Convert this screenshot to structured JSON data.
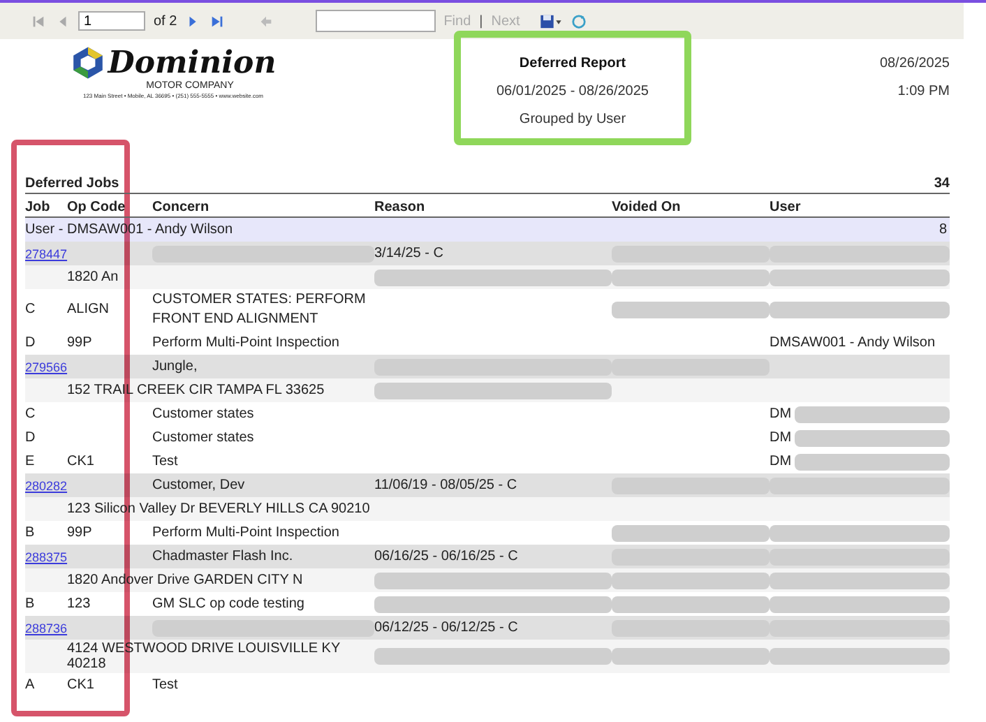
{
  "toolbar": {
    "page": "1",
    "page_count": "of 2",
    "find_label": "Find",
    "separator": "|",
    "next_label": "Next",
    "next_disabled": true
  },
  "header": {
    "logo_name": "Dominion",
    "logo_sub": "MOTOR COMPANY",
    "address": "123 Main Street • Mobile, AL 36695 • (251) 555-5555 • www.website.com",
    "title": "Deferred Report",
    "date_range": "06/01/2025 - 08/26/2025",
    "grouping": "Grouped by User",
    "date": "08/26/2025",
    "time": "1:09 PM"
  },
  "section": {
    "title": "Deferred Jobs",
    "count": "34"
  },
  "columns": [
    "Job",
    "Op Code",
    "Concern",
    "Reason",
    "Voided On",
    "User"
  ],
  "rows": [
    {
      "kind": "group",
      "label": "User - DMSAW001 - Andy Wilson",
      "count": "8"
    },
    {
      "kind": "job",
      "job": "278447",
      "reason": "3/14/25 - C",
      "redacted": {
        "concern": true,
        "voided_on": true,
        "user": true
      }
    },
    {
      "kind": "address",
      "address": "1820 An",
      "redacted": {
        "reason": true,
        "voided_on": true,
        "user": true
      }
    },
    {
      "kind": "line",
      "job": "C",
      "op_code": "ALIGN",
      "concern": "CUSTOMER STATES: PERFORM FRONT END ALIGNMENT",
      "redacted": {
        "voided_on": true,
        "user": true
      }
    },
    {
      "kind": "line",
      "job": "D",
      "op_code": "99P",
      "concern": "Perform Multi-Point Inspection",
      "user": "DMSAW001 - Andy Wilson"
    },
    {
      "kind": "job",
      "job": "279566",
      "concern": "Jungle,",
      "redacted": {
        "reason": true,
        "voided_on": true
      }
    },
    {
      "kind": "address",
      "address": "152 TRAIL CREEK CIR TAMPA FL 33625",
      "redacted": {
        "reason": true
      }
    },
    {
      "kind": "line",
      "job": "C",
      "concern": "Customer states",
      "user": "DM",
      "redacted": {
        "user": true
      }
    },
    {
      "kind": "line",
      "job": "D",
      "concern": "Customer states",
      "user": "DM",
      "redacted": {
        "user": true
      }
    },
    {
      "kind": "line",
      "job": "E",
      "op_code": "CK1",
      "concern": "Test",
      "user": "DM",
      "redacted": {
        "user": true
      }
    },
    {
      "kind": "job",
      "job": "280282",
      "concern": "Customer, Dev",
      "reason": "11/06/19 - 08/05/25 - C",
      "redacted": {
        "voided_on": true,
        "user": true
      }
    },
    {
      "kind": "address",
      "address": "123 Silicon Valley Dr BEVERLY HILLS CA 90210"
    },
    {
      "kind": "line",
      "job": "B",
      "op_code": "99P",
      "concern": "Perform Multi-Point Inspection",
      "redacted": {
        "voided_on": true,
        "user": true
      }
    },
    {
      "kind": "job",
      "job": "288375",
      "concern": "Chadmaster Flash Inc.",
      "reason": "06/16/25 - 06/16/25 - C",
      "redacted": {
        "voided_on": true,
        "user": true
      }
    },
    {
      "kind": "address",
      "address": "1820 Andover Drive GARDEN CITY N",
      "redacted": {
        "reason": true,
        "voided_on": true,
        "user": true
      }
    },
    {
      "kind": "line",
      "job": "B",
      "op_code": "123",
      "concern": "GM SLC op code testing",
      "redacted": {
        "reason": true,
        "voided_on": true,
        "user": true
      }
    },
    {
      "kind": "job",
      "job": "288736",
      "reason": "06/12/25 - 06/12/25 - C",
      "redacted": {
        "concern": true,
        "voided_on": true,
        "user": true
      }
    },
    {
      "kind": "address",
      "address": "4124 WESTWOOD DRIVE LOUISVILLE KY 40218",
      "redacted": {
        "reason": true,
        "voided_on": true,
        "user": true
      }
    },
    {
      "kind": "line",
      "job": "A",
      "op_code": "CK1",
      "concern": "Test"
    }
  ]
}
